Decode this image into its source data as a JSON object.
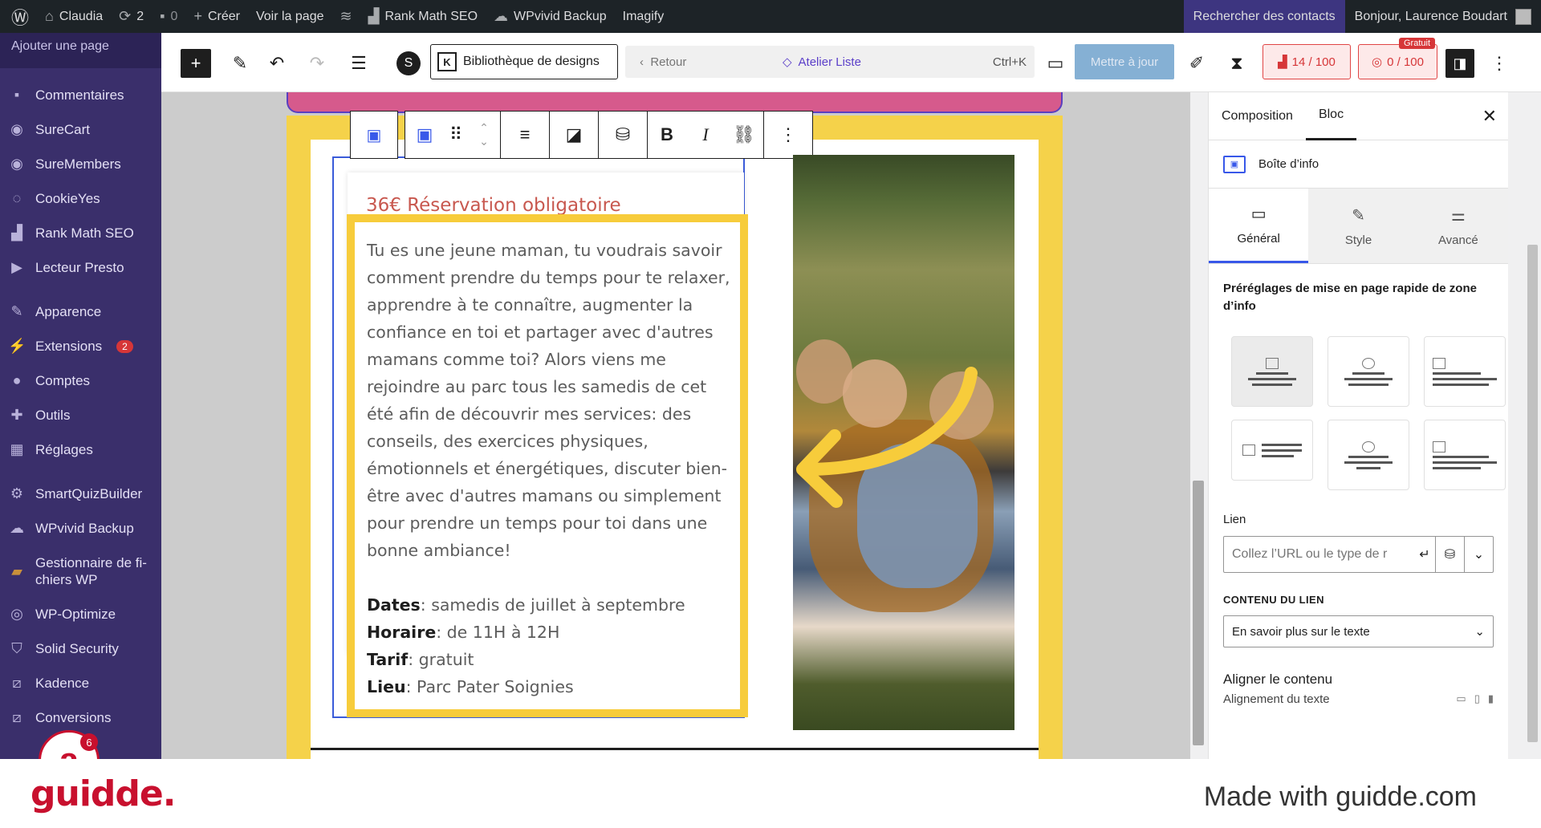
{
  "admin_bar": {
    "site_name": "Claudia",
    "updates_count": "2",
    "comments_count": "0",
    "create_label": "Créer",
    "view_page_label": "Voir la page",
    "rank_math_label": "Rank Math SEO",
    "wpvivid_label": "WPvivid Backup",
    "imagify_label": "Imagify",
    "search_contacts_label": "Rechercher des contacts",
    "greeting": "Bonjour, Laurence Boudart"
  },
  "sidebar": {
    "top_link": "Ajouter une page",
    "items": [
      {
        "label": "Commentaires",
        "icon": "comment-icon"
      },
      {
        "label": "SureCart",
        "icon": "surecart-icon"
      },
      {
        "label": "SureMembers",
        "icon": "suremembers-icon"
      },
      {
        "label": "CookieYes",
        "icon": "cookie-icon"
      },
      {
        "label": "Rank Math SEO",
        "icon": "chart-icon"
      },
      {
        "label": "Lecteur Presto",
        "icon": "presto-icon"
      },
      {
        "label": "Apparence",
        "icon": "brush-icon"
      },
      {
        "label": "Extensions",
        "icon": "plug-icon",
        "badge": "2"
      },
      {
        "label": "Comptes",
        "icon": "user-icon"
      },
      {
        "label": "Outils",
        "icon": "wrench-icon"
      },
      {
        "label": "Réglages",
        "icon": "settings-icon"
      },
      {
        "label": "SmartQuizBuilder",
        "icon": "gear-icon"
      },
      {
        "label": "WPvivid Backup",
        "icon": "cloud-icon"
      },
      {
        "label": "Gestionnaire de fi-\nchiers WP",
        "icon": "folder-icon"
      },
      {
        "label": "WP-Optimize",
        "icon": "optimize-icon"
      },
      {
        "label": "Solid Security",
        "icon": "shield-icon"
      },
      {
        "label": "Kadence",
        "icon": "kadence-icon"
      },
      {
        "label": "Conversions",
        "icon": "conversions-icon"
      }
    ]
  },
  "editor_toolbar": {
    "design_library_label": "Bibliothèque de designs",
    "back_label": "Retour",
    "document_title": "Atelier Liste",
    "shortcut": "Ctrl+K",
    "update_label": "Mettre à jour",
    "seo_score": "14 / 100",
    "content_score": "0 / 100",
    "free_badge": "Gratuit"
  },
  "canvas": {
    "card_title": "36€ Réservation obligatoire",
    "body_text": "Tu es une jeune maman, tu voudrais savoir comment prendre du temps pour te relaxer, apprendre à te connaître, augmenter la confiance en toi et partager avec d'autres mamans comme toi? Alors viens me rejoindre au parc tous les samedis de cet été afin de découvrir mes services: des conseils, des exercices physiques, émotionnels et énergétiques, discuter bien-être avec d'autres mamans ou simplement pour prendre un temps pour toi dans une bonne ambiance!",
    "details": [
      {
        "label": "Dates",
        "value": ": samedis de juillet à septembre"
      },
      {
        "label": "Horaire",
        "value": ": de 11H à 12H"
      },
      {
        "label": "Tarif",
        "value": ": gratuit"
      },
      {
        "label": "Lieu",
        "value": ": Parc Pater Soignies"
      }
    ]
  },
  "right_panel": {
    "tab_composition": "Composition",
    "tab_bloc": "Bloc",
    "block_name": "Boîte d’info",
    "sub_tabs": [
      "Général",
      "Style",
      "Avancé"
    ],
    "presets_heading": "Préréglages de mise en page rapide de zone d’info",
    "link_label": "Lien",
    "link_placeholder": "Collez l’URL ou le type de r",
    "link_content_label": "CONTENU DU LIEN",
    "link_content_value": "En savoir plus sur le texte",
    "align_title": "Aligner le contenu",
    "align_subtitle": "Alignement du texte"
  },
  "footer": {
    "brand": "guidde.",
    "made_with": "Made with guidde.com",
    "floating_badge": "6"
  },
  "colors": {
    "admin_bar": "#1d2327",
    "sidebar": "#3a2f6b",
    "accent_blue": "#3858e9",
    "highlight_yellow": "#f7cc3b",
    "guidde_red": "#c8102e"
  }
}
